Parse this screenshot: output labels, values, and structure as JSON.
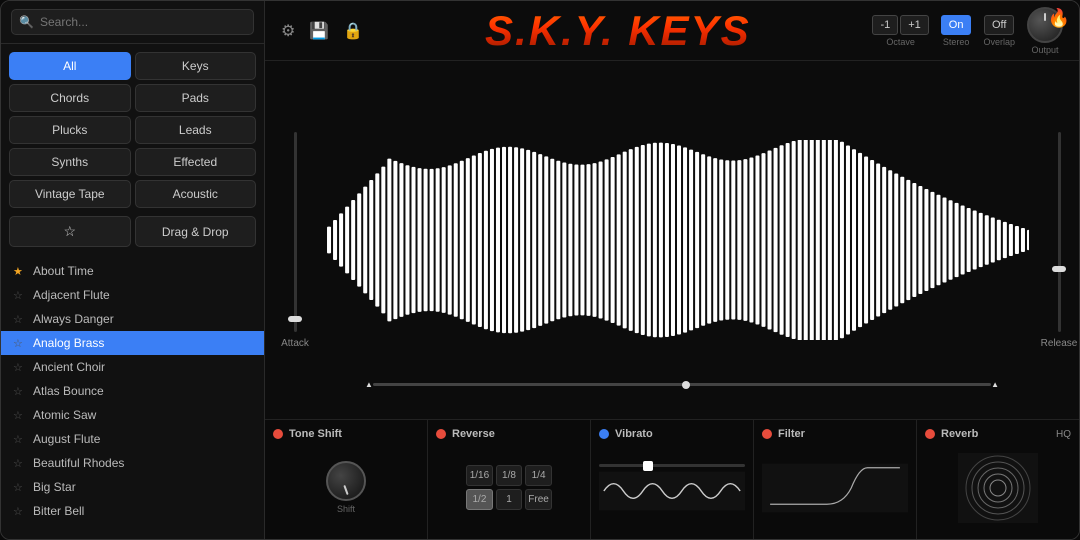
{
  "app": {
    "title": "S.K.Y. KEYS"
  },
  "header": {
    "octave_minus": "-1",
    "octave_plus": "+1",
    "octave_label": "Octave",
    "stereo_on": "On",
    "stereo_label": "Stereo",
    "overlap_off": "Off",
    "overlap_label": "Overlap",
    "output_label": "Output"
  },
  "sidebar": {
    "search_placeholder": "Search...",
    "categories": [
      {
        "id": "all",
        "label": "All",
        "active": true
      },
      {
        "id": "keys",
        "label": "Keys",
        "active": false
      },
      {
        "id": "chords",
        "label": "Chords",
        "active": false
      },
      {
        "id": "pads",
        "label": "Pads",
        "active": false
      },
      {
        "id": "plucks",
        "label": "Plucks",
        "active": false
      },
      {
        "id": "leads",
        "label": "Leads",
        "active": false
      },
      {
        "id": "synths",
        "label": "Synths",
        "active": false
      },
      {
        "id": "effected",
        "label": "Effected",
        "active": false
      },
      {
        "id": "vintage-tape",
        "label": "Vintage Tape",
        "active": false
      },
      {
        "id": "acoustic",
        "label": "Acoustic",
        "active": false
      }
    ],
    "drag_drop_label": "Drag & Drop",
    "presets": [
      {
        "id": "about-time",
        "label": "About Time",
        "starred": true,
        "active": false
      },
      {
        "id": "adjacent-flute",
        "label": "Adjacent Flute",
        "starred": false,
        "active": false
      },
      {
        "id": "always-danger",
        "label": "Always Danger",
        "starred": false,
        "active": false
      },
      {
        "id": "analog-brass",
        "label": "Analog Brass",
        "starred": false,
        "active": true
      },
      {
        "id": "ancient-choir",
        "label": "Ancient Choir",
        "starred": false,
        "active": false
      },
      {
        "id": "atlas-bounce",
        "label": "Atlas Bounce",
        "starred": false,
        "active": false
      },
      {
        "id": "atomic-saw",
        "label": "Atomic Saw",
        "starred": false,
        "active": false
      },
      {
        "id": "august-flute",
        "label": "August Flute",
        "starred": false,
        "active": false
      },
      {
        "id": "beautiful-rhodes",
        "label": "Beautiful Rhodes",
        "starred": false,
        "active": false
      },
      {
        "id": "big-star",
        "label": "Big Star",
        "starred": false,
        "active": false
      },
      {
        "id": "bitter-bell",
        "label": "Bitter Bell",
        "starred": false,
        "active": false
      }
    ]
  },
  "waveform": {
    "attack_label": "Attack",
    "release_label": "Release"
  },
  "modules": {
    "tone_shift": {
      "title": "Tone Shift",
      "knob_label": "Shift",
      "enabled": true
    },
    "reverse": {
      "title": "Reverse",
      "enabled": true,
      "buttons": [
        "1/16",
        "1/8",
        "1/4",
        "1/2",
        "1",
        "Free"
      ],
      "active_index": 3
    },
    "vibrato": {
      "title": "Vibrato",
      "enabled": true
    },
    "filter": {
      "title": "Filter",
      "enabled": true
    },
    "reverb": {
      "title": "Reverb",
      "enabled": true,
      "hq_label": "HQ"
    }
  }
}
